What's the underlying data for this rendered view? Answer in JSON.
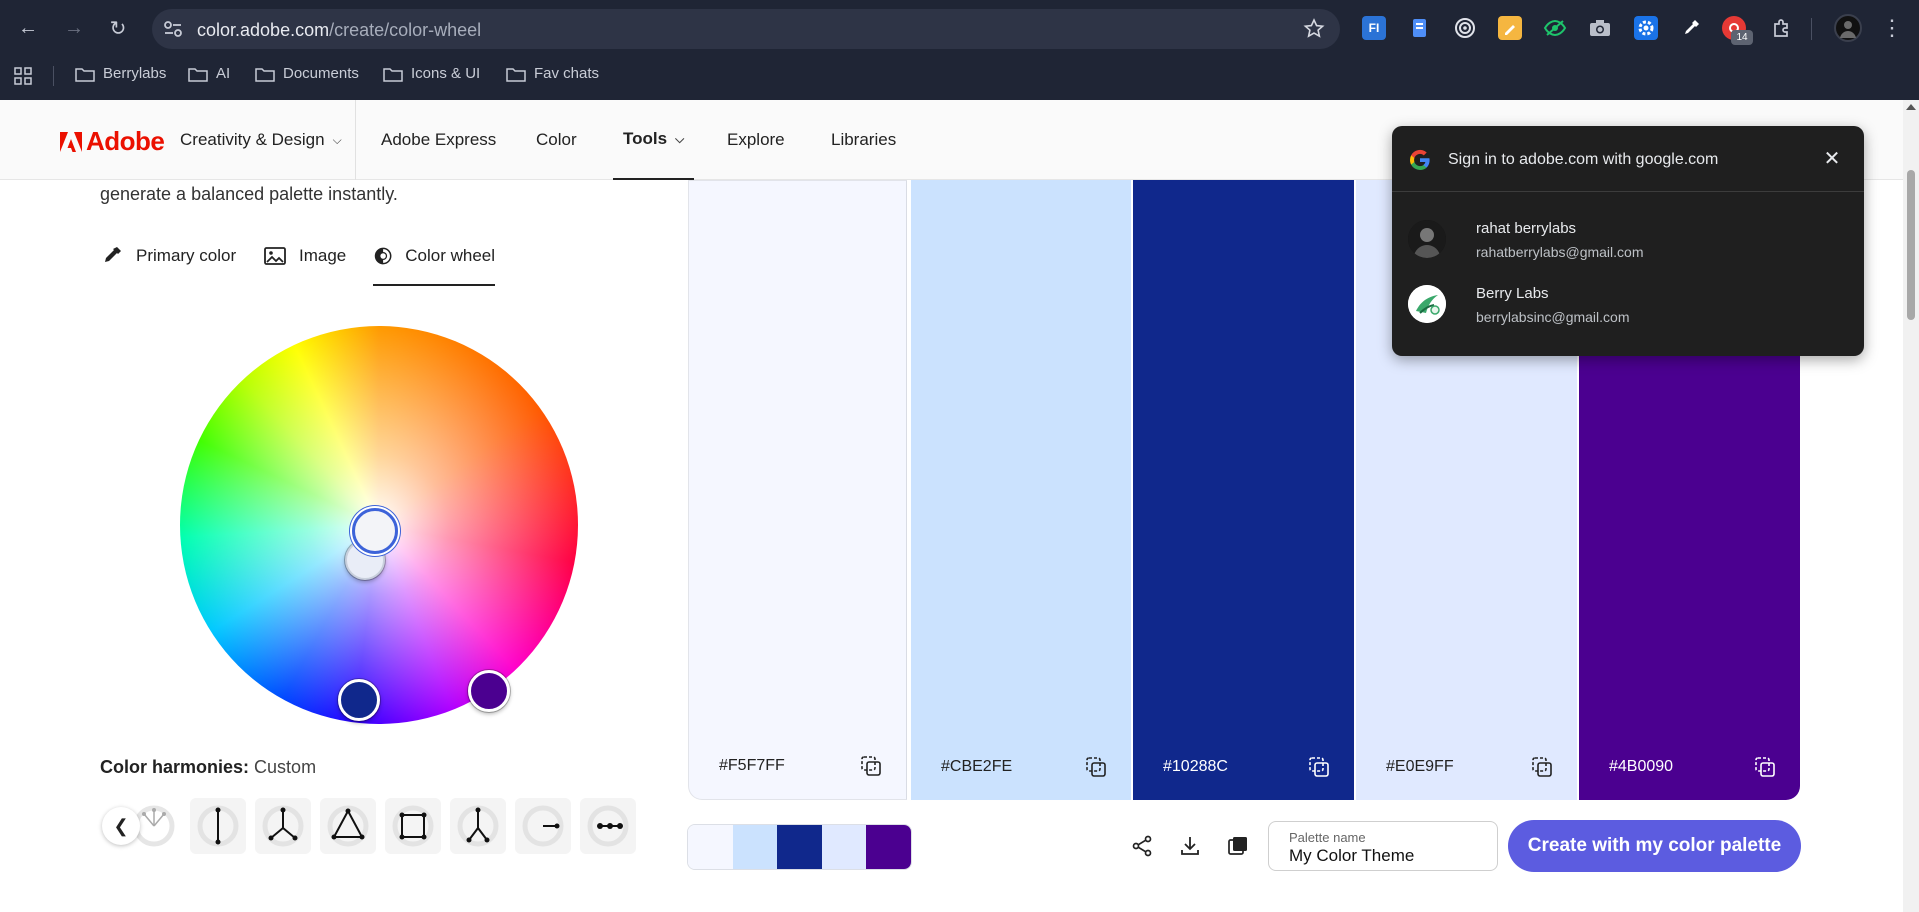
{
  "browser": {
    "url_host": "color.adobe.com",
    "url_path": "/create/color-wheel",
    "extension_badge": "14",
    "ext_fi_label": "FI",
    "bookmarks": [
      {
        "label": "Berrylabs"
      },
      {
        "label": "AI"
      },
      {
        "label": "Documents"
      },
      {
        "label": "Icons & UI"
      },
      {
        "label": "Fav chats"
      }
    ]
  },
  "header": {
    "logo": "Adobe",
    "nav": [
      {
        "label": "Creativity & Design"
      },
      {
        "label": "Adobe Express"
      },
      {
        "label": "Color"
      },
      {
        "label": "Tools"
      },
      {
        "label": "Explore"
      },
      {
        "label": "Libraries"
      }
    ]
  },
  "left": {
    "intro": "generate a balanced palette instantly.",
    "tabs": [
      {
        "label": "Primary color"
      },
      {
        "label": "Image"
      },
      {
        "label": "Color wheel"
      }
    ],
    "harmony_label": "Color harmonies:",
    "harmony_value": "Custom"
  },
  "swatches": [
    {
      "hex": "#F5F7FF",
      "color": "#F5F7FF"
    },
    {
      "hex": "#CBE2FE",
      "color": "#CBE2FE"
    },
    {
      "hex": "#10288C",
      "color": "#10288C"
    },
    {
      "hex": "#E0E9FF",
      "color": "#E0E9FF"
    },
    {
      "hex": "#4B0090",
      "color": "#4B0090"
    }
  ],
  "bottom": {
    "palette_name_label": "Palette name",
    "palette_name_value": "My Color Theme",
    "cta": "Create with my color palette"
  },
  "google_popup": {
    "title": "Sign in to adobe.com with google.com",
    "accounts": [
      {
        "name": "rahat berrylabs",
        "email": "rahatberrylabs@gmail.com"
      },
      {
        "name": "Berry Labs",
        "email": "berrylabsinc@gmail.com"
      }
    ]
  }
}
